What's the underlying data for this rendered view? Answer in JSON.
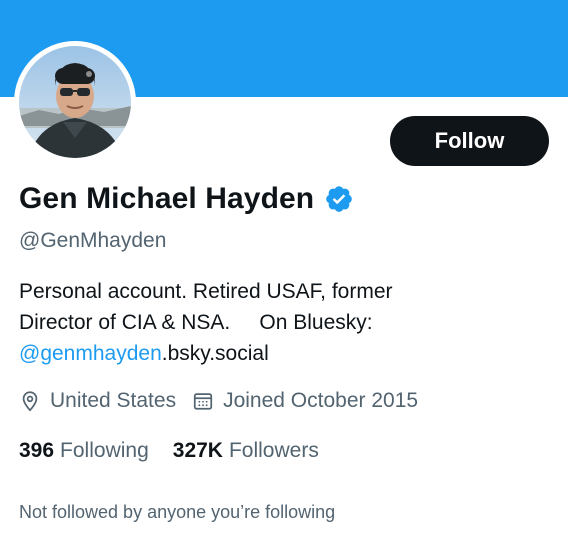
{
  "profile": {
    "display_name": "Gen Michael Hayden",
    "handle": "@GenMhayden",
    "bio_line1": "Personal account. Retired USAF, former",
    "bio_line2": "Director of CIA & NSA.     On Bluesky:",
    "bio_link": "@genmhayden",
    "bio_link_rest": ".bsky.social",
    "location": "United States",
    "joined": "Joined October 2015",
    "following_count": "396",
    "following_label": "Following",
    "followers_count": "327K",
    "followers_label": "Followers",
    "not_followed_text": "Not followed by anyone you’re following"
  },
  "actions": {
    "follow_label": "Follow"
  },
  "icons": {
    "verified": "verified-badge-icon",
    "location": "location-pin-icon",
    "calendar": "calendar-icon"
  },
  "colors": {
    "banner": "#1d9bf0",
    "accent": "#1d9bf0",
    "button_bg": "#0f1419",
    "secondary_text": "#536471"
  }
}
